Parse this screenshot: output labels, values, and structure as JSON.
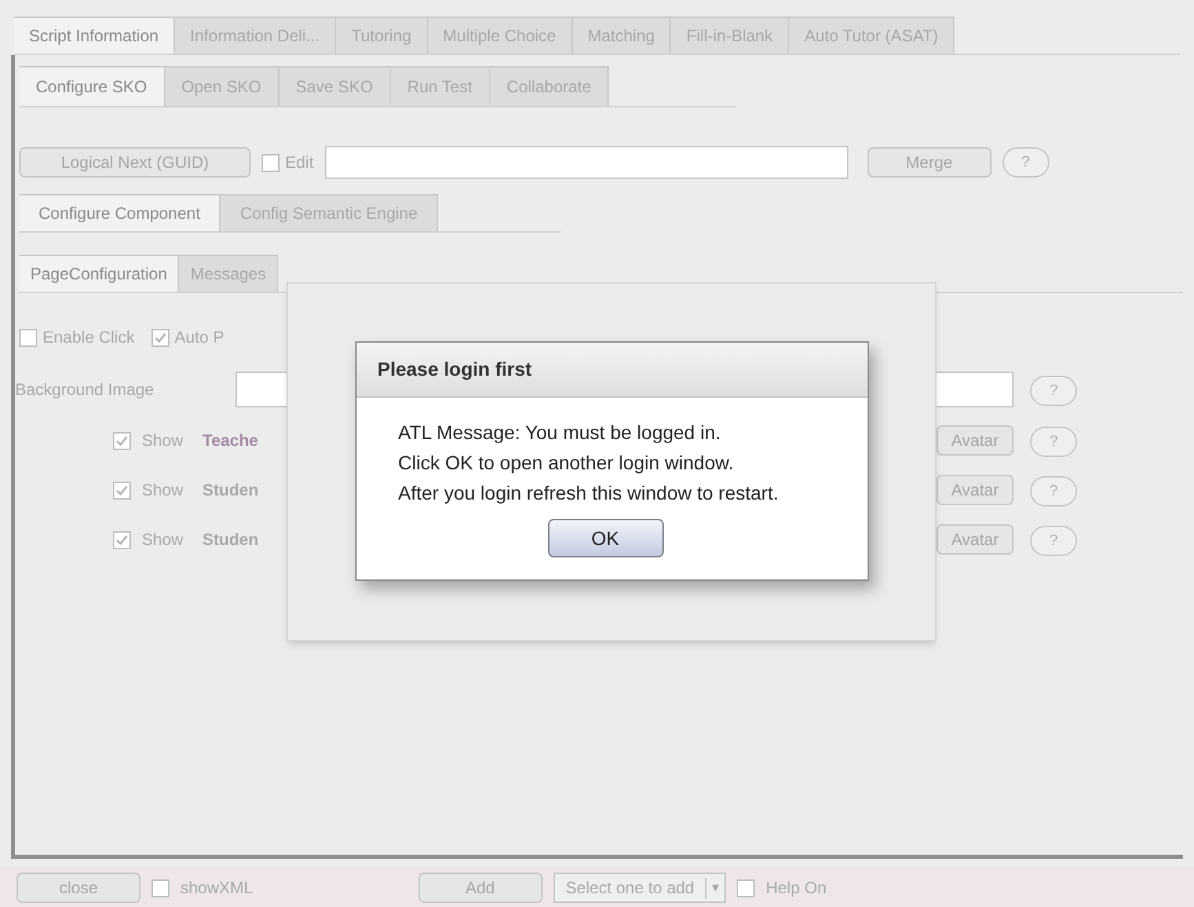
{
  "main_tabs": [
    {
      "label": "Script Information",
      "selected": true
    },
    {
      "label": "Information Deli...",
      "selected": false
    },
    {
      "label": "Tutoring",
      "selected": false
    },
    {
      "label": "Multiple Choice",
      "selected": false
    },
    {
      "label": "Matching",
      "selected": false
    },
    {
      "label": "Fill-in-Blank",
      "selected": false
    },
    {
      "label": "Auto Tutor (ASAT)",
      "selected": false
    }
  ],
  "sko_tabs": [
    {
      "label": "Configure SKO",
      "selected": true
    },
    {
      "label": "Open SKO",
      "selected": false
    },
    {
      "label": "Save SKO",
      "selected": false
    },
    {
      "label": "Run Test",
      "selected": false
    },
    {
      "label": "Collaborate",
      "selected": false
    }
  ],
  "guid_row": {
    "button": "Logical Next (GUID)",
    "edit": {
      "label": "Edit",
      "checked": false
    },
    "merge": "Merge",
    "help": "?"
  },
  "component_tabs": [
    {
      "label": "Configure Component",
      "selected": true
    },
    {
      "label": "Config Semantic Engine",
      "selected": false
    }
  ],
  "page_tabs": [
    {
      "label": "PageConfiguration",
      "selected": true
    },
    {
      "label": "Messages",
      "selected": false
    }
  ],
  "options": [
    {
      "label": "Enable Click",
      "checked": false
    },
    {
      "label": "Auto P",
      "checked": true
    }
  ],
  "background_image": {
    "label": "Background Image",
    "help": "?"
  },
  "avatars": [
    {
      "show": "Show",
      "checked": true,
      "name": "Teache",
      "highlight": true,
      "button": "Avatar",
      "help": "?"
    },
    {
      "show": "Show",
      "checked": true,
      "name": "Studen",
      "highlight": false,
      "button": "Avatar",
      "help": "?"
    },
    {
      "show": "Show",
      "checked": true,
      "name": "Studen",
      "highlight": false,
      "button": "Avatar",
      "help": "?"
    }
  ],
  "dialog": {
    "title": "Please login first",
    "lines": [
      "ATL Message: You must be logged in.",
      "Click OK to open another login window.",
      "After you login refresh this window to restart."
    ],
    "ok": "OK"
  },
  "bottom_bar": {
    "close": "close",
    "show_xml": {
      "label": "showXML",
      "checked": false
    },
    "add": "Add",
    "select": "Select one to add",
    "select_arrow": "▾",
    "help_on": {
      "label": "Help On",
      "checked": false
    }
  }
}
